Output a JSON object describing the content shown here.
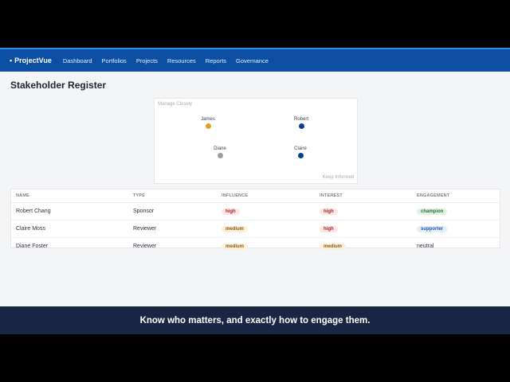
{
  "app": {
    "brand": "ProjectVue",
    "brand_dot": "•",
    "nav": [
      "Dashboard",
      "Portfolios",
      "Projects",
      "Resources",
      "Reports",
      "Governance"
    ]
  },
  "page": {
    "title": "Stakeholder Register"
  },
  "matrix": {
    "label_top_left": "Manage Closely",
    "label_bottom_right": "Keep Informed",
    "points": [
      {
        "name": "James",
        "color": "#e2a024"
      },
      {
        "name": "Robert",
        "color": "#0b3f8f"
      },
      {
        "name": "Diane",
        "color": "#9a9ea6"
      },
      {
        "name": "Claire",
        "color": "#0b3f8f"
      }
    ]
  },
  "table": {
    "headers": [
      "Name",
      "Type",
      "Influence",
      "Interest",
      "Engagement"
    ],
    "rows": [
      {
        "name": "Robert Chang",
        "type": "Sponsor",
        "influence": "high",
        "interest": "high",
        "engagement": "champion"
      },
      {
        "name": "Claire Moss",
        "type": "Reviewer",
        "influence": "medium",
        "interest": "high",
        "engagement": "supporter"
      },
      {
        "name": "Diane Foster",
        "type": "Reviewer",
        "influence": "medium",
        "interest": "medium",
        "engagement": "neutral"
      }
    ]
  },
  "caption": "Know who matters, and exactly how to engage them."
}
